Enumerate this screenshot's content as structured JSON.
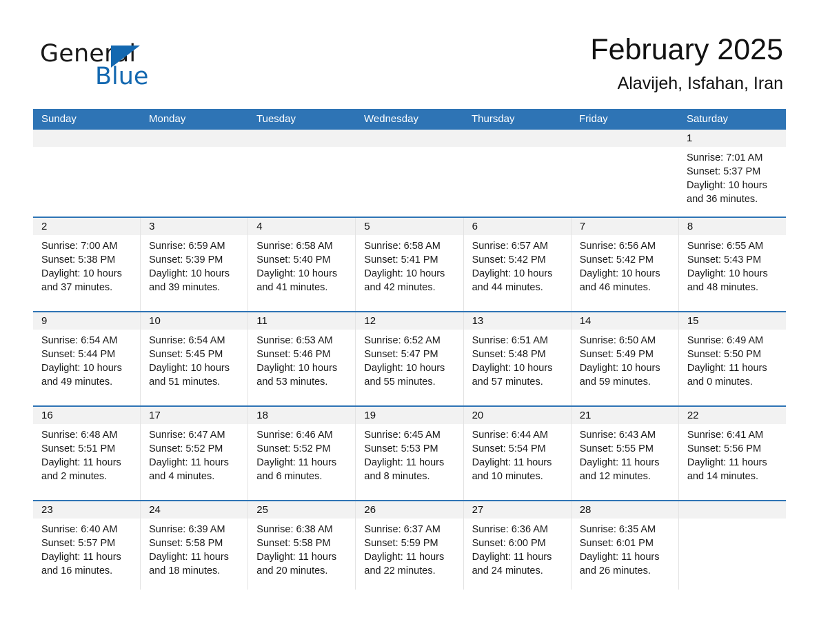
{
  "brand": {
    "name_part1": "General",
    "name_part2": "Blue",
    "logo_color": "#1368b0"
  },
  "header": {
    "title": "February 2025",
    "subtitle": "Alavijeh, Isfahan, Iran"
  },
  "theme": {
    "header_blue": "#2e74b5",
    "daynum_band": "#f2f2f2",
    "cell_divider": "#e3e3e3"
  },
  "weekdays": [
    "Sunday",
    "Monday",
    "Tuesday",
    "Wednesday",
    "Thursday",
    "Friday",
    "Saturday"
  ],
  "weeks": [
    [
      {
        "day": "",
        "empty": true
      },
      {
        "day": "",
        "empty": true
      },
      {
        "day": "",
        "empty": true
      },
      {
        "day": "",
        "empty": true
      },
      {
        "day": "",
        "empty": true
      },
      {
        "day": "",
        "empty": true
      },
      {
        "day": "1",
        "sunrise": "Sunrise: 7:01 AM",
        "sunset": "Sunset: 5:37 PM",
        "daylight": "Daylight: 10 hours and 36 minutes."
      }
    ],
    [
      {
        "day": "2",
        "sunrise": "Sunrise: 7:00 AM",
        "sunset": "Sunset: 5:38 PM",
        "daylight": "Daylight: 10 hours and 37 minutes."
      },
      {
        "day": "3",
        "sunrise": "Sunrise: 6:59 AM",
        "sunset": "Sunset: 5:39 PM",
        "daylight": "Daylight: 10 hours and 39 minutes."
      },
      {
        "day": "4",
        "sunrise": "Sunrise: 6:58 AM",
        "sunset": "Sunset: 5:40 PM",
        "daylight": "Daylight: 10 hours and 41 minutes."
      },
      {
        "day": "5",
        "sunrise": "Sunrise: 6:58 AM",
        "sunset": "Sunset: 5:41 PM",
        "daylight": "Daylight: 10 hours and 42 minutes."
      },
      {
        "day": "6",
        "sunrise": "Sunrise: 6:57 AM",
        "sunset": "Sunset: 5:42 PM",
        "daylight": "Daylight: 10 hours and 44 minutes."
      },
      {
        "day": "7",
        "sunrise": "Sunrise: 6:56 AM",
        "sunset": "Sunset: 5:42 PM",
        "daylight": "Daylight: 10 hours and 46 minutes."
      },
      {
        "day": "8",
        "sunrise": "Sunrise: 6:55 AM",
        "sunset": "Sunset: 5:43 PM",
        "daylight": "Daylight: 10 hours and 48 minutes."
      }
    ],
    [
      {
        "day": "9",
        "sunrise": "Sunrise: 6:54 AM",
        "sunset": "Sunset: 5:44 PM",
        "daylight": "Daylight: 10 hours and 49 minutes."
      },
      {
        "day": "10",
        "sunrise": "Sunrise: 6:54 AM",
        "sunset": "Sunset: 5:45 PM",
        "daylight": "Daylight: 10 hours and 51 minutes."
      },
      {
        "day": "11",
        "sunrise": "Sunrise: 6:53 AM",
        "sunset": "Sunset: 5:46 PM",
        "daylight": "Daylight: 10 hours and 53 minutes."
      },
      {
        "day": "12",
        "sunrise": "Sunrise: 6:52 AM",
        "sunset": "Sunset: 5:47 PM",
        "daylight": "Daylight: 10 hours and 55 minutes."
      },
      {
        "day": "13",
        "sunrise": "Sunrise: 6:51 AM",
        "sunset": "Sunset: 5:48 PM",
        "daylight": "Daylight: 10 hours and 57 minutes."
      },
      {
        "day": "14",
        "sunrise": "Sunrise: 6:50 AM",
        "sunset": "Sunset: 5:49 PM",
        "daylight": "Daylight: 10 hours and 59 minutes."
      },
      {
        "day": "15",
        "sunrise": "Sunrise: 6:49 AM",
        "sunset": "Sunset: 5:50 PM",
        "daylight": "Daylight: 11 hours and 0 minutes."
      }
    ],
    [
      {
        "day": "16",
        "sunrise": "Sunrise: 6:48 AM",
        "sunset": "Sunset: 5:51 PM",
        "daylight": "Daylight: 11 hours and 2 minutes."
      },
      {
        "day": "17",
        "sunrise": "Sunrise: 6:47 AM",
        "sunset": "Sunset: 5:52 PM",
        "daylight": "Daylight: 11 hours and 4 minutes."
      },
      {
        "day": "18",
        "sunrise": "Sunrise: 6:46 AM",
        "sunset": "Sunset: 5:52 PM",
        "daylight": "Daylight: 11 hours and 6 minutes."
      },
      {
        "day": "19",
        "sunrise": "Sunrise: 6:45 AM",
        "sunset": "Sunset: 5:53 PM",
        "daylight": "Daylight: 11 hours and 8 minutes."
      },
      {
        "day": "20",
        "sunrise": "Sunrise: 6:44 AM",
        "sunset": "Sunset: 5:54 PM",
        "daylight": "Daylight: 11 hours and 10 minutes."
      },
      {
        "day": "21",
        "sunrise": "Sunrise: 6:43 AM",
        "sunset": "Sunset: 5:55 PM",
        "daylight": "Daylight: 11 hours and 12 minutes."
      },
      {
        "day": "22",
        "sunrise": "Sunrise: 6:41 AM",
        "sunset": "Sunset: 5:56 PM",
        "daylight": "Daylight: 11 hours and 14 minutes."
      }
    ],
    [
      {
        "day": "23",
        "sunrise": "Sunrise: 6:40 AM",
        "sunset": "Sunset: 5:57 PM",
        "daylight": "Daylight: 11 hours and 16 minutes."
      },
      {
        "day": "24",
        "sunrise": "Sunrise: 6:39 AM",
        "sunset": "Sunset: 5:58 PM",
        "daylight": "Daylight: 11 hours and 18 minutes."
      },
      {
        "day": "25",
        "sunrise": "Sunrise: 6:38 AM",
        "sunset": "Sunset: 5:58 PM",
        "daylight": "Daylight: 11 hours and 20 minutes."
      },
      {
        "day": "26",
        "sunrise": "Sunrise: 6:37 AM",
        "sunset": "Sunset: 5:59 PM",
        "daylight": "Daylight: 11 hours and 22 minutes."
      },
      {
        "day": "27",
        "sunrise": "Sunrise: 6:36 AM",
        "sunset": "Sunset: 6:00 PM",
        "daylight": "Daylight: 11 hours and 24 minutes."
      },
      {
        "day": "28",
        "sunrise": "Sunrise: 6:35 AM",
        "sunset": "Sunset: 6:01 PM",
        "daylight": "Daylight: 11 hours and 26 minutes."
      },
      {
        "day": "",
        "empty": true
      }
    ]
  ]
}
